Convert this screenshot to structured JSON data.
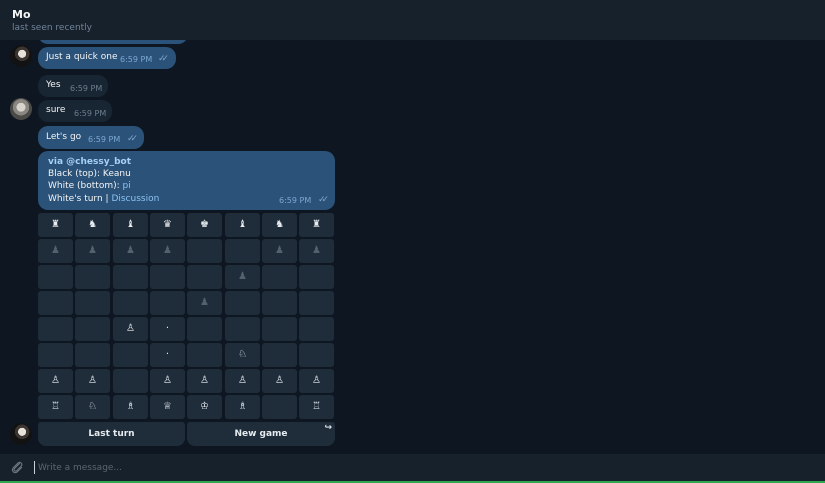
{
  "header": {
    "name": "Mo",
    "status": "last seen recently"
  },
  "messages": [
    {
      "text": "Just a quick one",
      "time": "6:59 PM",
      "checks": "✓✓"
    },
    {
      "text": "Yes",
      "time": "6:59 PM"
    },
    {
      "text": "sure",
      "time": "6:59 PM"
    },
    {
      "text": "Let's go",
      "time": "6:59 PM",
      "checks": "✓✓"
    }
  ],
  "game": {
    "via_prefix": "via ",
    "via_bot": "@chessy_bot",
    "black_label": "Black (top): ",
    "black_name": "Keanu",
    "white_label": "White (bottom): ",
    "white_name": "pi",
    "turn_text": "White's turn | ",
    "discussion": "Discussion",
    "time": "6:59 PM",
    "checks": "✓✓"
  },
  "board": [
    [
      "♜",
      "♞",
      "♝",
      "♛",
      "♚",
      "♝",
      "♞",
      "♜"
    ],
    [
      "♟",
      "♟",
      "♟",
      "♟",
      "",
      "",
      "♟",
      "♟"
    ],
    [
      "",
      "",
      "",
      "",
      "",
      "♟",
      "",
      ""
    ],
    [
      "",
      "",
      "",
      "",
      "♟",
      "",
      "",
      ""
    ],
    [
      "",
      "",
      "♙",
      "·",
      "",
      "",
      "",
      ""
    ],
    [
      "",
      "",
      "",
      "·",
      "",
      "♘",
      "",
      ""
    ],
    [
      "♙",
      "♙",
      "",
      "♙",
      "♙",
      "♙",
      "♙",
      "♙"
    ],
    [
      "♖",
      "♘",
      "♗",
      "♕",
      "♔",
      "♗",
      "",
      "♖"
    ]
  ],
  "buttons": {
    "last_turn": "Last turn",
    "new_game": "New game",
    "share_icon": "↪"
  },
  "composer": {
    "placeholder": "Write a message...",
    "attach_icon": "paperclip-icon"
  }
}
